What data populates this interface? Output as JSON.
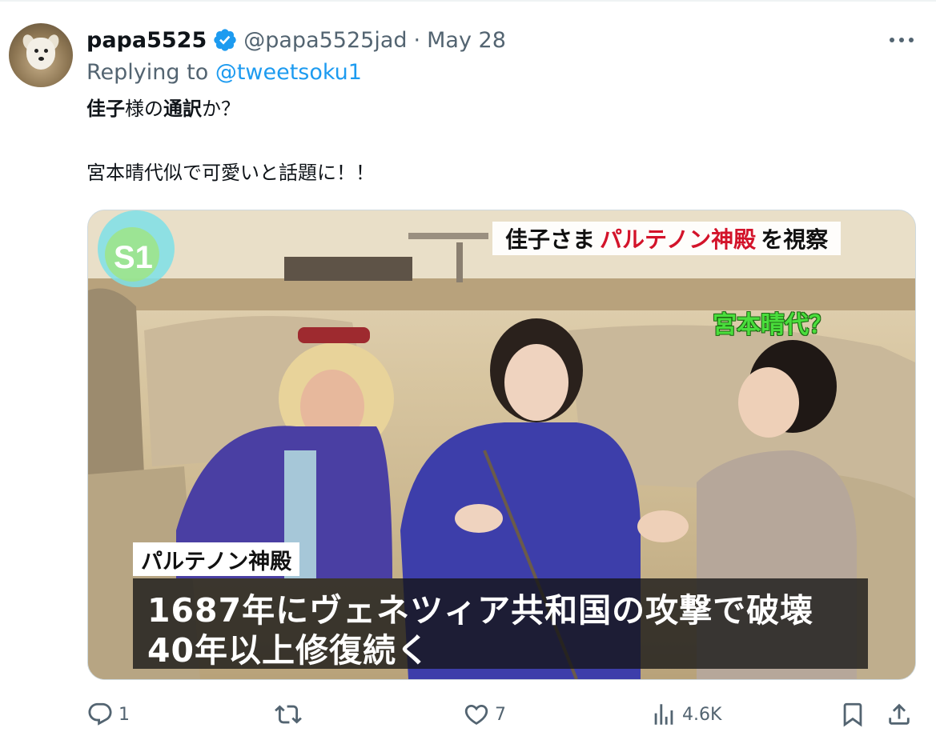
{
  "tweet": {
    "author_name": "papa5525",
    "author_handle": "@papa5525jad",
    "separator": "·",
    "date": "May 28",
    "replying_prefix": "Replying to",
    "replying_to": "@tweetsoku1",
    "text_line1_a": "佳子",
    "text_line1_b": "様の",
    "text_line1_c": "通訳",
    "text_line1_d": "か？",
    "text_line2": "宮本晴代似で可愛いと話題に！！"
  },
  "media": {
    "channel_logo": "S1",
    "headline_prefix": "佳子さま",
    "headline_red": "パルテノン神殿",
    "headline_suffix": "を視察",
    "speculation": "宮本晴代？",
    "location_label": "パルテノン神殿",
    "caption_line1": "1687年にヴェネツィア共和国の攻撃で破壊",
    "caption_line2": "40年以上修復続く"
  },
  "actions": {
    "replies": "1",
    "retweets": "",
    "likes": "7",
    "views": "4.6K"
  },
  "colors": {
    "accent": "#1d9bf0",
    "text_primary": "#0f1419",
    "text_secondary": "#536471",
    "headline_red": "#d3132a",
    "speculation_green": "#4ade3c"
  },
  "icons": [
    "verified-badge-icon",
    "more-icon",
    "reply-icon",
    "retweet-icon",
    "like-icon",
    "views-icon",
    "bookmark-icon",
    "share-icon"
  ]
}
